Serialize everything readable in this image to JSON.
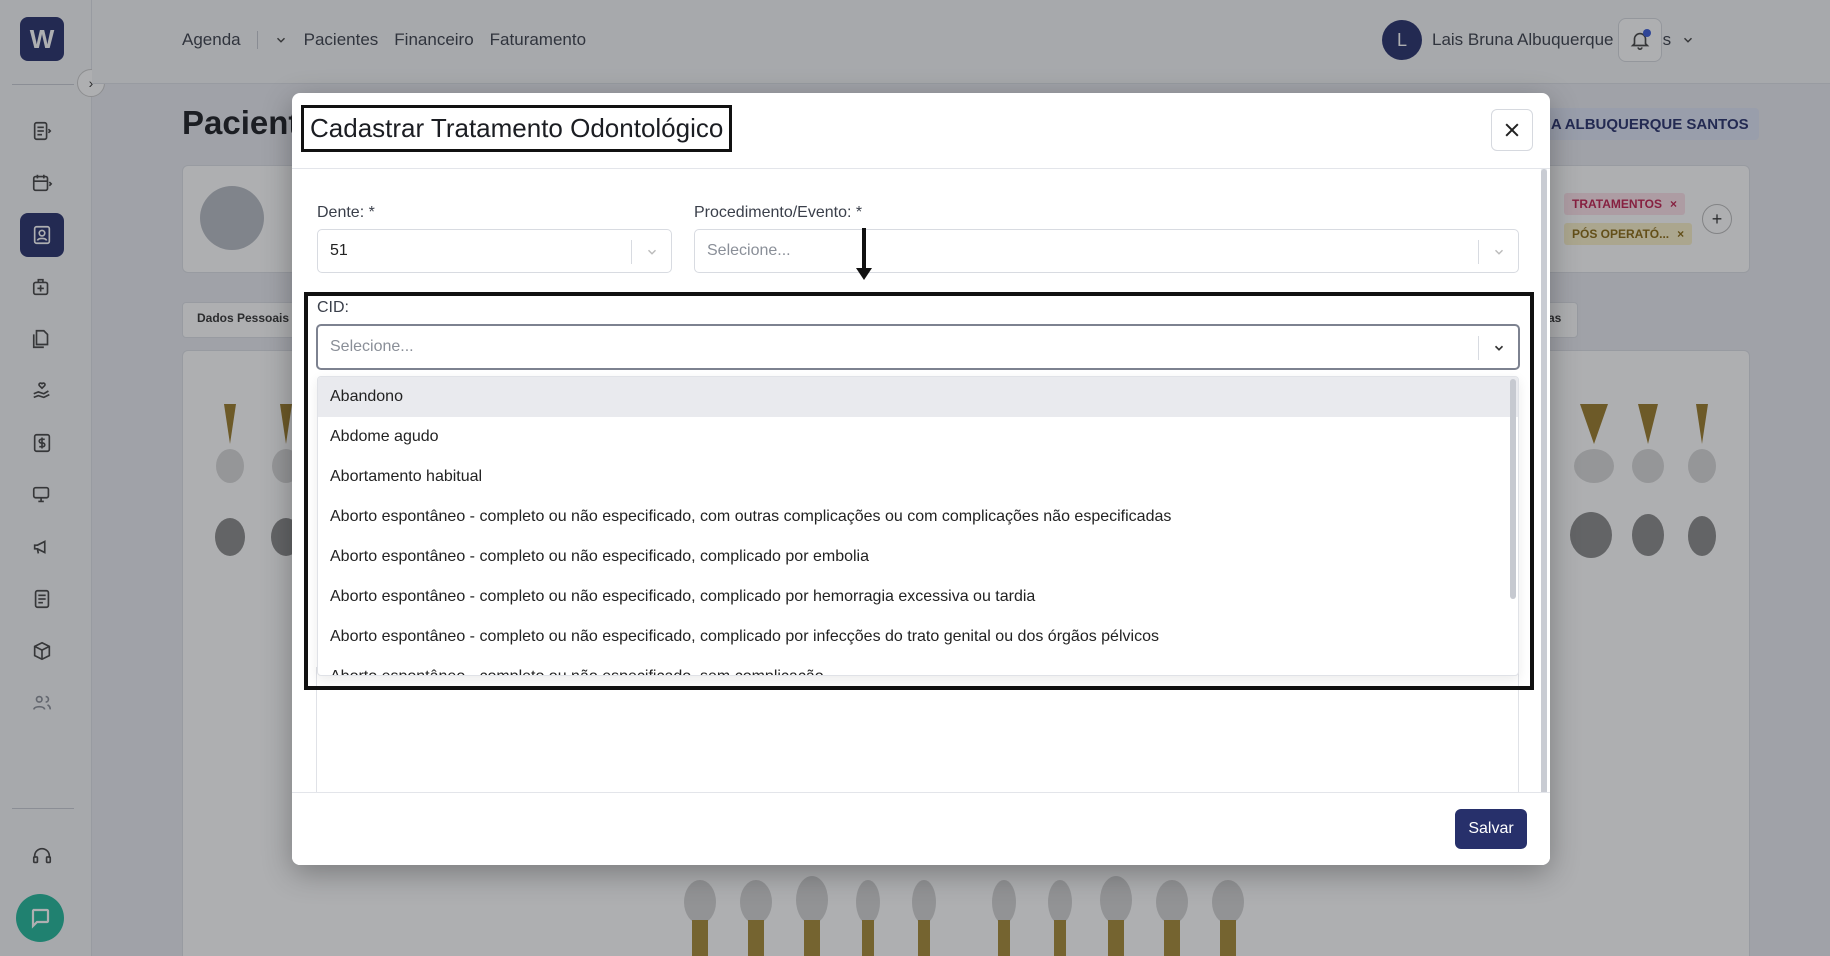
{
  "app": {
    "logo_letter": "W"
  },
  "topnav": {
    "agenda": "Agenda",
    "pacientes": "Pacientes",
    "financeiro": "Financeiro",
    "faturamento": "Faturamento"
  },
  "user": {
    "initial": "L",
    "name": "Lais Bruna Albuquerque Santos"
  },
  "page": {
    "title": "Pacient",
    "owner": "NA ALBUQUERQUE SANTOS"
  },
  "patient_tags": [
    "TRATAMENTOS",
    "PÓS OPERATÓ..."
  ],
  "tabs": {
    "first": "Dados Pessoais",
    "last": "as"
  },
  "modal": {
    "title": "Cadastrar Tratamento Odontológico",
    "dente_label": "Dente: *",
    "dente_value": "51",
    "procedimento_label": "Procedimento/Evento: *",
    "procedimento_placeholder": "Selecione...",
    "cid_label": "CID:",
    "cid_placeholder": "Selecione...",
    "save_label": "Salvar"
  },
  "cid_options": [
    "Abandono",
    "Abdome agudo",
    "Abortamento habitual",
    "Aborto espontâneo - completo ou não especificado, com outras complicações ou com complicações não especificadas",
    "Aborto espontâneo - completo ou não especificado, complicado por embolia",
    "Aborto espontâneo - completo ou não especificado, complicado por hemorragia excessiva ou tardia",
    "Aborto espontâneo - completo ou não especificado, complicado por infecções do trato genital ou dos órgãos pélvicos",
    "Aborto espontâneo - completo ou não especificado, sem complicação"
  ],
  "colors": {
    "brand": "#27306b",
    "accent_teal": "#21b89a"
  }
}
